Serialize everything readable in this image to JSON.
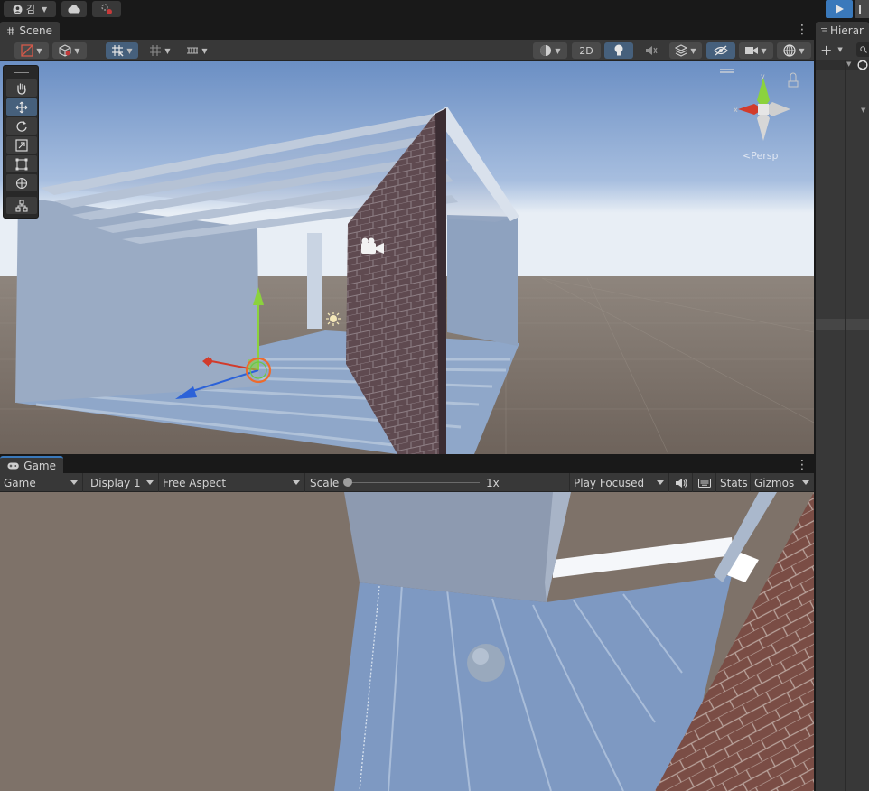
{
  "topbar": {
    "account_label": "김",
    "play_icon": "play-icon",
    "pause_icon": "pause-icon"
  },
  "scene": {
    "tab_label": "Scene",
    "toolbar": {
      "btn_2d": "2D"
    },
    "gizmo": {
      "projection_label": "Persp",
      "x_label": "x",
      "y_label": "y"
    }
  },
  "game": {
    "tab_label": "Game",
    "toolbar": {
      "view_select": "Game",
      "display_select": "Display 1",
      "aspect_select": "Free Aspect",
      "scale_label": "Scale",
      "scale_value_label": "1x",
      "scale_value": 1,
      "play_mode_select": "Play Focused",
      "stats_label": "Stats",
      "gizmos_label": "Gizmos"
    }
  },
  "hierarchy": {
    "tab_label": "Hierar"
  },
  "colors": {
    "accent": "#3a79bb",
    "panel": "#383838",
    "background": "#191919",
    "active_tool": "#46607c"
  }
}
